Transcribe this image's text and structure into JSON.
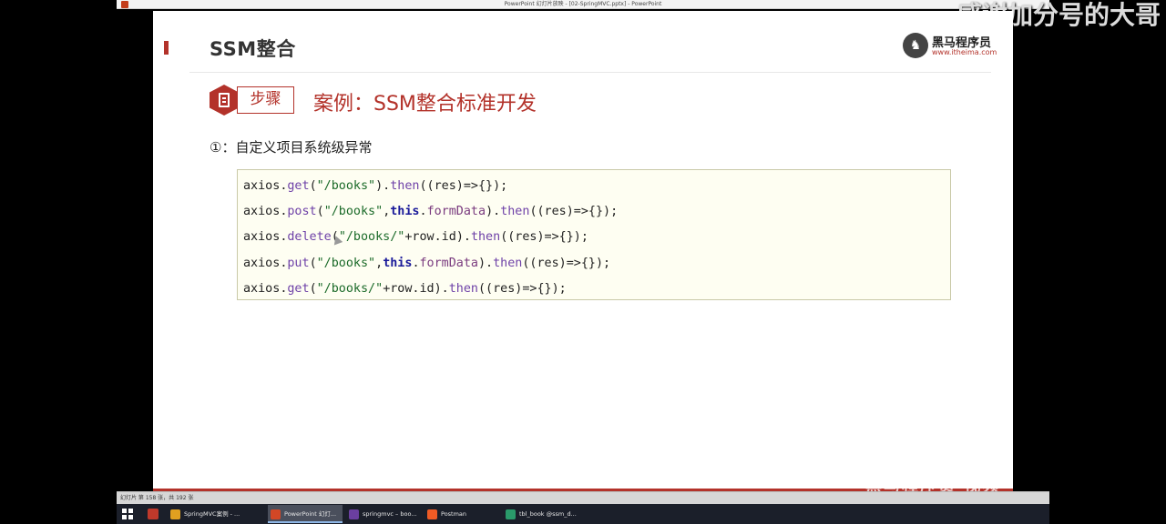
{
  "window": {
    "title": "PowerPoint 幻灯片放映 - [02-SpringMVC.pptx] - PowerPoint"
  },
  "overlay_caption": "感谢加分号的大哥",
  "slide": {
    "title": "SSM整合",
    "logo": {
      "brand": "黑马程序员",
      "url": "www.itheima.com"
    },
    "step_label": "步骤",
    "case_title": "案例：SSM整合标准开发",
    "point": "①：自定义项目系统级异常",
    "code_lines": [
      [
        {
          "t": "axios",
          "c": "id"
        },
        {
          "t": ".",
          "c": "pu"
        },
        {
          "t": "get",
          "c": "fn"
        },
        {
          "t": "(",
          "c": "pu"
        },
        {
          "t": "\"/books\"",
          "c": "str"
        },
        {
          "t": ").",
          "c": "pu"
        },
        {
          "t": "then",
          "c": "fn"
        },
        {
          "t": "((res)=>{});",
          "c": "pu"
        }
      ],
      [
        {
          "t": "axios",
          "c": "id"
        },
        {
          "t": ".",
          "c": "pu"
        },
        {
          "t": "post",
          "c": "fn"
        },
        {
          "t": "(",
          "c": "pu"
        },
        {
          "t": "\"/books\"",
          "c": "str"
        },
        {
          "t": ",",
          "c": "pu"
        },
        {
          "t": "this",
          "c": "kw"
        },
        {
          "t": ".",
          "c": "pu"
        },
        {
          "t": "formData",
          "c": "pr"
        },
        {
          "t": ").",
          "c": "pu"
        },
        {
          "t": "then",
          "c": "fn"
        },
        {
          "t": "((res)=>{});",
          "c": "pu"
        }
      ],
      [
        {
          "t": "axios",
          "c": "id"
        },
        {
          "t": ".",
          "c": "pu"
        },
        {
          "t": "delete",
          "c": "fn"
        },
        {
          "t": "(",
          "c": "pu"
        },
        {
          "t": "\"/books/\"",
          "c": "str"
        },
        {
          "t": "+row.id",
          "c": "id"
        },
        {
          "t": ").",
          "c": "pu"
        },
        {
          "t": "then",
          "c": "fn"
        },
        {
          "t": "((res)=>{});",
          "c": "pu"
        }
      ],
      [
        {
          "t": "axios",
          "c": "id"
        },
        {
          "t": ".",
          "c": "pu"
        },
        {
          "t": "put",
          "c": "fn"
        },
        {
          "t": "(",
          "c": "pu"
        },
        {
          "t": "\"/books\"",
          "c": "str"
        },
        {
          "t": ",",
          "c": "pu"
        },
        {
          "t": "this",
          "c": "kw"
        },
        {
          "t": ".",
          "c": "pu"
        },
        {
          "t": "formData",
          "c": "pr"
        },
        {
          "t": ").",
          "c": "pu"
        },
        {
          "t": "then",
          "c": "fn"
        },
        {
          "t": "((res)=>{});",
          "c": "pu"
        }
      ],
      [
        {
          "t": "axios",
          "c": "id"
        },
        {
          "t": ".",
          "c": "pu"
        },
        {
          "t": "get",
          "c": "fn"
        },
        {
          "t": "(",
          "c": "pu"
        },
        {
          "t": "\"/books/\"",
          "c": "str"
        },
        {
          "t": "+row.id",
          "c": "id"
        },
        {
          "t": ").",
          "c": "pu"
        },
        {
          "t": "then",
          "c": "fn"
        },
        {
          "t": "((res)=>{});",
          "c": "pu"
        }
      ]
    ]
  },
  "watermark": "黑马程序员 视频",
  "statusbar": {
    "text": "幻灯片 第 158 张，共 192 张"
  },
  "taskbar": {
    "items": [
      {
        "label": "SpringMVC案例 - ...",
        "icon": "chrome-icon",
        "color": "#e0a020",
        "active": false
      },
      {
        "label": "PowerPoint 幻灯...",
        "icon": "powerpoint-icon",
        "color": "#d24726",
        "active": true
      },
      {
        "label": "springmvc – boo...",
        "icon": "intellij-icon",
        "color": "#6b3fa0",
        "active": false
      },
      {
        "label": "Postman",
        "icon": "postman-icon",
        "color": "#ef5b25",
        "active": false
      },
      {
        "label": "tbl_book @ssm_d...",
        "icon": "datagrip-icon",
        "color": "#2a9a6a",
        "active": false
      }
    ]
  },
  "colors": {
    "accent": "#b3322a",
    "code_background": "#fefef2"
  }
}
